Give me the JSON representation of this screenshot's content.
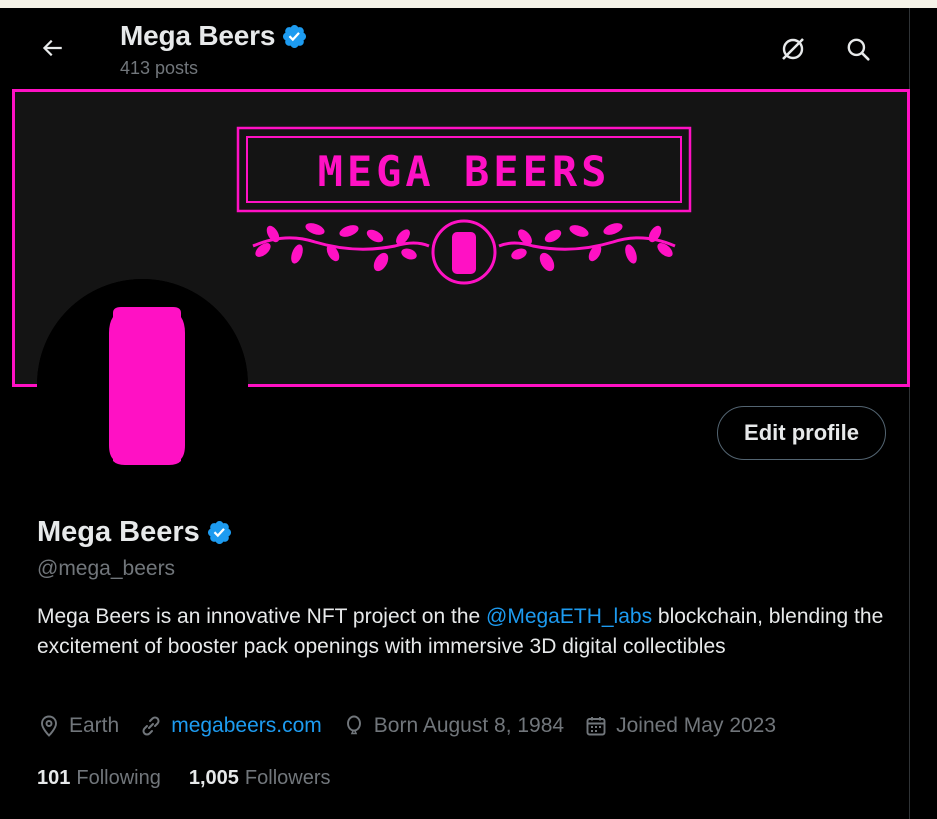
{
  "header": {
    "name": "Mega Beers",
    "posts": "413 posts",
    "icons": [
      "back-arrow-icon",
      "verified-badge-icon",
      "grok-icon",
      "search-icon"
    ]
  },
  "banner": {
    "text": "MEGA BEERS",
    "color": "#ff11c4"
  },
  "profile": {
    "name": "Mega Beers",
    "handle": "@mega_beers",
    "edit_label": "Edit profile",
    "bio_pre": "Mega Beers is an innovative NFT project on the ",
    "bio_mention": "@MegaETH_labs",
    "bio_post": " blockchain, blending the excitement of booster pack openings with immersive 3D digital collectibles",
    "location": "Earth",
    "website": "megabeers.com",
    "born": "Born August 8, 1984",
    "joined": "Joined May 2023",
    "following_count": "101",
    "following_label": "Following",
    "followers_count": "1,005",
    "followers_label": "Followers"
  },
  "colors": {
    "accent": "#1d9bf0",
    "brand_pink": "#ff11c4",
    "muted": "#71767b",
    "text": "#e7e9ea"
  }
}
